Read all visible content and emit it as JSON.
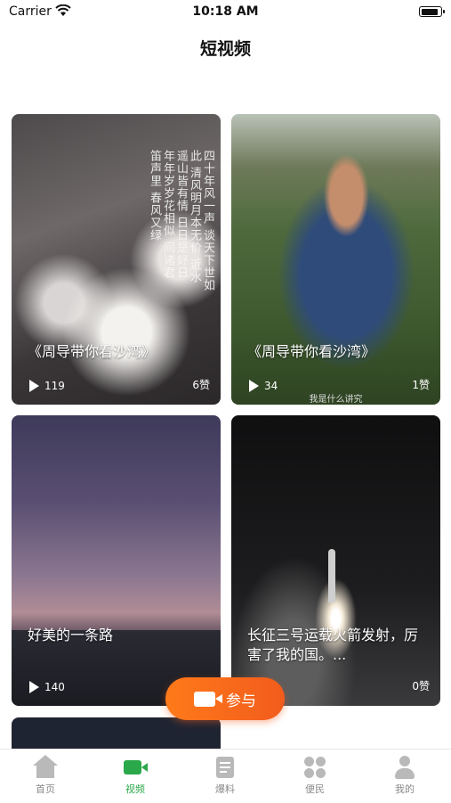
{
  "status_bar": {
    "carrier": "Carrier",
    "time": "10:18 AM"
  },
  "nav": {
    "title": "短视频"
  },
  "videos": [
    {
      "title": "《周导带你看沙湾》",
      "views": "119",
      "likes": "6赞",
      "poem": "四十年风一声 谈天下世如此 清风明月本无价 近水遥山皆有情 日日是好日 年年岁岁花相似 间诸君 笛声里 春风又绿"
    },
    {
      "title": "《周导带你看沙湾》",
      "views": "34",
      "likes": "1赞",
      "subtitle": "我是什么讲究"
    },
    {
      "title": "好美的一条路",
      "views": "140",
      "likes": ""
    },
    {
      "title": "长征三号运载火箭发射，厉害了我的国。...",
      "views": "",
      "likes": "0赞"
    }
  ],
  "join_button": {
    "label": "参与",
    "icon": "video-camera-icon"
  },
  "tabbar": {
    "items": [
      {
        "label": "首页",
        "icon": "home-icon",
        "active": false
      },
      {
        "label": "视频",
        "icon": "video-icon",
        "active": true
      },
      {
        "label": "爆料",
        "icon": "document-icon",
        "active": false
      },
      {
        "label": "便民",
        "icon": "grid-icon",
        "active": false
      },
      {
        "label": "我的",
        "icon": "user-icon",
        "active": false
      }
    ]
  },
  "colors": {
    "accent": "#2aa84a",
    "join_gradient_start": "#ff7a1a",
    "join_gradient_end": "#f25c1c",
    "inactive": "#8a8a8a"
  }
}
